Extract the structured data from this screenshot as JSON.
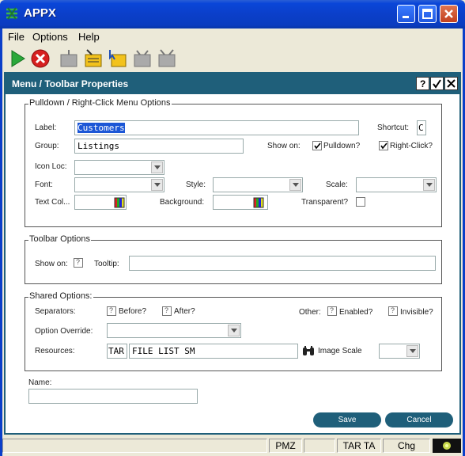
{
  "window": {
    "title": "APPX"
  },
  "menu": [
    "File",
    "Options",
    "Help"
  ],
  "dialog": {
    "title": "Menu / Toolbar Properties",
    "pulldown": {
      "legend": "Pulldown / Right-Click Menu Options",
      "label_label": "Label:",
      "label_value": "Customers",
      "shortcut_label": "Shortcut:",
      "shortcut_value": "C",
      "group_label": "Group:",
      "group_value": "Listings",
      "show_on_label": "Show on:",
      "pulldown_label": "Pulldown?",
      "rightclick_label": "Right-Click?",
      "icon_loc_label": "Icon Loc:",
      "font_label": "Font:",
      "style_label": "Style:",
      "scale_label": "Scale:",
      "text_col_label": "Text Col...",
      "background_label": "Background:",
      "transparent_label": "Transparent?"
    },
    "toolbar_opts": {
      "legend": "Toolbar Options",
      "show_on_label": "Show on:",
      "tooltip_label": "Tooltip:",
      "tooltip_value": ""
    },
    "shared": {
      "legend": "Shared Options:",
      "separators_label": "Separators:",
      "before_label": "Before?",
      "after_label": "After?",
      "other_label": "Other:",
      "enabled_label": "Enabled?",
      "invisible_label": "Invisible?",
      "override_label": "Option Override:",
      "resources_label": "Resources:",
      "resource_app": "TAR",
      "resource_name": "FILE LIST SM",
      "image_scale_label": "Image Scale"
    },
    "name_label": "Name:",
    "name_value": "",
    "save_label": "Save",
    "cancel_label": "Cancel"
  },
  "status": {
    "seg1": "PMZ",
    "seg2": "",
    "seg3": "TAR TA",
    "seg4": "Chg"
  },
  "colors": {
    "accent": "#1f5f7a",
    "titlebar": "#0b3fc9"
  }
}
